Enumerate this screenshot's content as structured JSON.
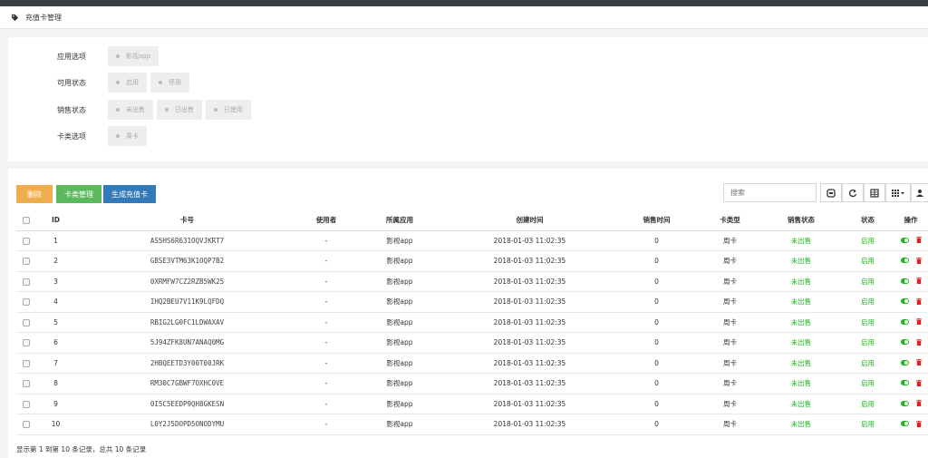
{
  "breadcrumb": {
    "title": "充值卡管理"
  },
  "filters": [
    {
      "label": "应用选项",
      "options": [
        "影视app"
      ]
    },
    {
      "label": "可用状态",
      "options": [
        "启用",
        "停用"
      ]
    },
    {
      "label": "销售状态",
      "options": [
        "未出售",
        "已出售",
        "已使用"
      ]
    },
    {
      "label": "卡类选项",
      "options": [
        "周卡"
      ]
    }
  ],
  "toolbar": {
    "delete_label": "删除",
    "card_type_label": "卡类管理",
    "generate_label": "生成充值卡",
    "search_placeholder": "搜索"
  },
  "table": {
    "columns": [
      "ID",
      "卡号",
      "使用者",
      "所属应用",
      "创建时间",
      "销售时间",
      "卡类型",
      "销售状态",
      "状态",
      "操作"
    ],
    "rows": [
      [
        "1",
        "AS5HS6R631OQVJKRT7",
        "-",
        "影视app",
        "2018-01-03 11:02:35",
        "0",
        "周卡",
        "未出售",
        "启用"
      ],
      [
        "2",
        "GBSE3VTM63K1OQP7B2",
        "-",
        "影视app",
        "2018-01-03 11:02:35",
        "0",
        "周卡",
        "未出售",
        "启用"
      ],
      [
        "3",
        "0XRMFW7CZ2RZB5WK25",
        "-",
        "影视app",
        "2018-01-03 11:02:35",
        "0",
        "周卡",
        "未出售",
        "启用"
      ],
      [
        "4",
        "IHQ2BEU7V11K9LQFDQ",
        "-",
        "影视app",
        "2018-01-03 11:02:35",
        "0",
        "周卡",
        "未出售",
        "启用"
      ],
      [
        "5",
        "RBIG2LG0FC1LDWAXAV",
        "-",
        "影视app",
        "2018-01-03 11:02:35",
        "0",
        "周卡",
        "未出售",
        "启用"
      ],
      [
        "6",
        "5J94ZFK8UN7ANAQ0MG",
        "-",
        "影视app",
        "2018-01-03 11:02:35",
        "0",
        "周卡",
        "未出售",
        "启用"
      ],
      [
        "7",
        "2HBQEETD3Y00T00JRK",
        "-",
        "影视app",
        "2018-01-03 11:02:35",
        "0",
        "周卡",
        "未出售",
        "启用"
      ],
      [
        "8",
        "RM30C7GBWF7OXHC0VE",
        "-",
        "影视app",
        "2018-01-03 11:02:35",
        "0",
        "周卡",
        "未出售",
        "启用"
      ],
      [
        "9",
        "0I5C5EEDP9QH8GKESN",
        "-",
        "影视app",
        "2018-01-03 11:02:35",
        "0",
        "周卡",
        "未出售",
        "启用"
      ],
      [
        "10",
        "L0Y2J5DOPD5ONODYMU",
        "-",
        "影视app",
        "2018-01-03 11:02:35",
        "0",
        "周卡",
        "未出售",
        "启用"
      ]
    ]
  },
  "footer": {
    "summary": "显示第 1 到第 10 条记录，总共 10 条记录"
  },
  "colors": {
    "delete": "#f0ad4e",
    "card_type": "#5cb85c",
    "generate": "#337ab7",
    "status_green": "#1ab91a",
    "trash_red": "#e02020"
  },
  "icons": {
    "breadcrumb": "tag-icon",
    "toolbar": [
      "toggle-icon",
      "refresh-icon",
      "columns-icon",
      "grid-menu-icon",
      "export-icon"
    ],
    "ops": [
      "toggle-switch-icon",
      "trash-icon"
    ]
  }
}
